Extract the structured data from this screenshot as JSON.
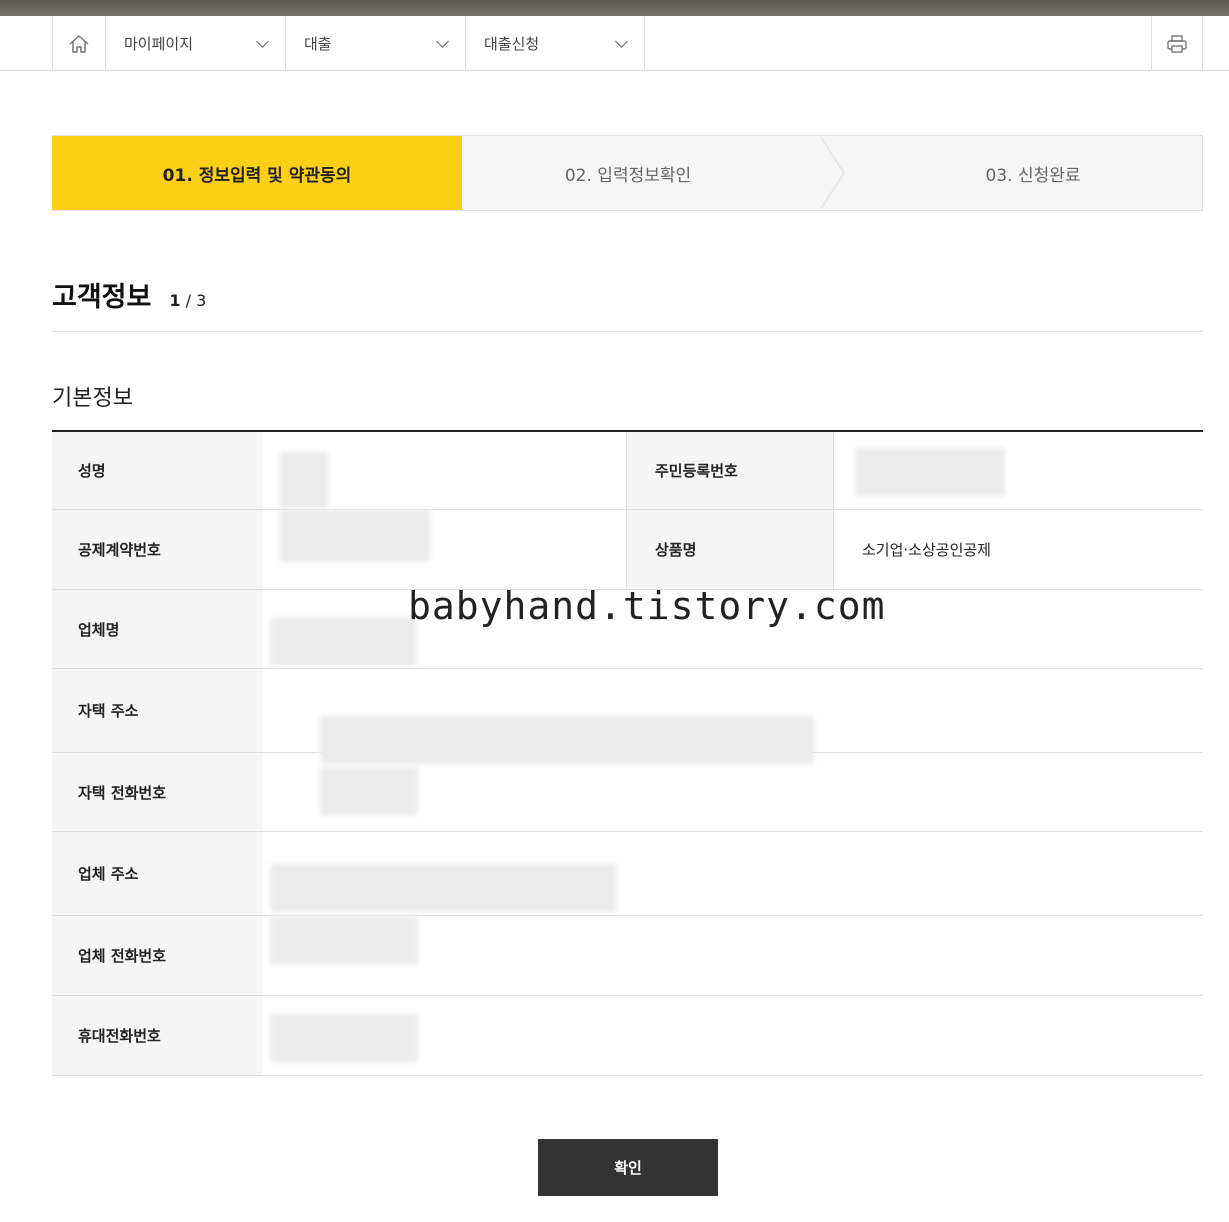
{
  "nav": {
    "home_icon": "home-icon",
    "items": [
      {
        "label": "마이페이지"
      },
      {
        "label": "대출"
      },
      {
        "label": "대출신청"
      }
    ],
    "print_icon": "printer-icon"
  },
  "steps": [
    {
      "label": "01. 정보입력 및 약관동의",
      "active": true
    },
    {
      "label": "02. 입력정보확인",
      "active": false
    },
    {
      "label": "03. 신청완료",
      "active": false
    }
  ],
  "section": {
    "title": "고객정보",
    "page_current": "1",
    "page_sep": " / ",
    "page_total": "3"
  },
  "subsection": {
    "title": "기본정보"
  },
  "fields": {
    "name_label": "성명",
    "rrn_label": "주민등록번호",
    "contract_no_label": "공제계약번호",
    "product_label": "상품명",
    "product_value": "소기업·소상공인공제",
    "company_label": "업체명",
    "home_addr_label": "자택 주소",
    "home_phone_label": "자택 전화번호",
    "company_addr_label": "업체 주소",
    "company_phone_label": "업체 전화번호",
    "mobile_label": "휴대전화번호"
  },
  "watermark": "babyhand.tistory.com",
  "confirm_button": "확인",
  "colors": {
    "accent": "#fdd017",
    "button": "#333333"
  }
}
